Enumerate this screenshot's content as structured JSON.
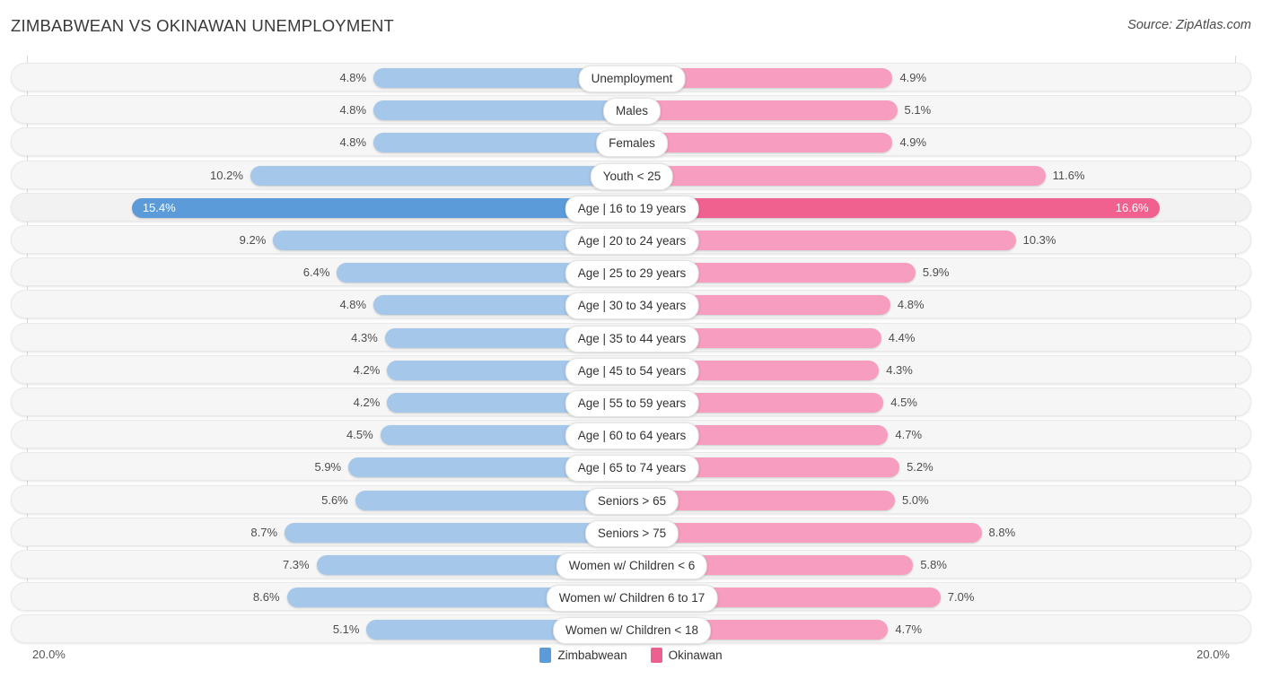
{
  "header": {
    "title": "ZIMBABWEAN VS OKINAWAN UNEMPLOYMENT",
    "source": "Source: ZipAtlas.com"
  },
  "axis": {
    "left_label": "20.0%",
    "right_label": "20.0%"
  },
  "legend": [
    {
      "label": "Zimbabwean",
      "color": "#5b9bd9"
    },
    {
      "label": "Okinawan",
      "color": "#ec5f91"
    }
  ],
  "colors": {
    "left_normal": "#a4c7ea",
    "right_normal": "#f79ec0",
    "left_highlight": "#5b9bd9",
    "right_highlight": "#f0618f",
    "row_bg": "#f6f6f6"
  },
  "chart_data": {
    "type": "bar",
    "orientation": "diverging-horizontal",
    "title": "ZIMBABWEAN VS OKINAWAN UNEMPLOYMENT",
    "xlabel": "",
    "ylabel": "",
    "xlim": [
      20.0,
      20.0
    ],
    "grid": false,
    "legend_position": "bottom-center",
    "unit": "%",
    "series": [
      {
        "name": "Zimbabwean",
        "values": [
          4.8,
          4.8,
          4.8,
          10.2,
          15.4,
          9.2,
          6.4,
          4.8,
          4.3,
          4.2,
          4.2,
          4.5,
          5.9,
          5.6,
          8.7,
          7.3,
          8.6,
          5.1
        ]
      },
      {
        "name": "Okinawan",
        "values": [
          4.9,
          5.1,
          4.9,
          11.6,
          16.6,
          10.3,
          5.9,
          4.8,
          4.4,
          4.3,
          4.5,
          4.7,
          5.2,
          5.0,
          8.8,
          5.8,
          7.0,
          4.7
        ]
      }
    ],
    "categories": [
      "Unemployment",
      "Males",
      "Females",
      "Youth < 25",
      "Age | 16 to 19 years",
      "Age | 20 to 24 years",
      "Age | 25 to 29 years",
      "Age | 30 to 34 years",
      "Age | 35 to 44 years",
      "Age | 45 to 54 years",
      "Age | 55 to 59 years",
      "Age | 60 to 64 years",
      "Age | 65 to 74 years",
      "Seniors > 65",
      "Seniors > 75",
      "Women w/ Children < 6",
      "Women w/ Children 6 to 17",
      "Women w/ Children < 18"
    ],
    "rows": [
      {
        "category": "Unemployment",
        "left_value": 4.8,
        "right_value": 4.9,
        "left_label": "4.8%",
        "right_label": "4.9%",
        "highlight": false
      },
      {
        "category": "Males",
        "left_value": 4.8,
        "right_value": 5.1,
        "left_label": "4.8%",
        "right_label": "5.1%",
        "highlight": false
      },
      {
        "category": "Females",
        "left_value": 4.8,
        "right_value": 4.9,
        "left_label": "4.8%",
        "right_label": "4.9%",
        "highlight": false
      },
      {
        "category": "Youth < 25",
        "left_value": 10.2,
        "right_value": 11.6,
        "left_label": "10.2%",
        "right_label": "11.6%",
        "highlight": false
      },
      {
        "category": "Age | 16 to 19 years",
        "left_value": 15.4,
        "right_value": 16.6,
        "left_label": "15.4%",
        "right_label": "16.6%",
        "highlight": true
      },
      {
        "category": "Age | 20 to 24 years",
        "left_value": 9.2,
        "right_value": 10.3,
        "left_label": "9.2%",
        "right_label": "10.3%",
        "highlight": false
      },
      {
        "category": "Age | 25 to 29 years",
        "left_value": 6.4,
        "right_value": 5.9,
        "left_label": "6.4%",
        "right_label": "5.9%",
        "highlight": false
      },
      {
        "category": "Age | 30 to 34 years",
        "left_value": 4.8,
        "right_value": 4.8,
        "left_label": "4.8%",
        "right_label": "4.8%",
        "highlight": false
      },
      {
        "category": "Age | 35 to 44 years",
        "left_value": 4.3,
        "right_value": 4.4,
        "left_label": "4.3%",
        "right_label": "4.4%",
        "highlight": false
      },
      {
        "category": "Age | 45 to 54 years",
        "left_value": 4.2,
        "right_value": 4.3,
        "left_label": "4.2%",
        "right_label": "4.3%",
        "highlight": false
      },
      {
        "category": "Age | 55 to 59 years",
        "left_value": 4.2,
        "right_value": 4.5,
        "left_label": "4.2%",
        "right_label": "4.5%",
        "highlight": false
      },
      {
        "category": "Age | 60 to 64 years",
        "left_value": 4.5,
        "right_value": 4.7,
        "left_label": "4.5%",
        "right_label": "4.7%",
        "highlight": false
      },
      {
        "category": "Age | 65 to 74 years",
        "left_value": 5.9,
        "right_value": 5.2,
        "left_label": "5.9%",
        "right_label": "5.2%",
        "highlight": false
      },
      {
        "category": "Seniors > 65",
        "left_value": 5.6,
        "right_value": 5.0,
        "left_label": "5.6%",
        "right_label": "5.0%",
        "highlight": false
      },
      {
        "category": "Seniors > 75",
        "left_value": 8.7,
        "right_value": 8.8,
        "left_label": "8.7%",
        "right_label": "8.8%",
        "highlight": false
      },
      {
        "category": "Women w/ Children < 6",
        "left_value": 7.3,
        "right_value": 5.8,
        "left_label": "7.3%",
        "right_label": "5.8%",
        "highlight": false
      },
      {
        "category": "Women w/ Children 6 to 17",
        "left_value": 8.6,
        "right_value": 7.0,
        "left_label": "8.6%",
        "right_label": "7.0%",
        "highlight": false
      },
      {
        "category": "Women w/ Children < 18",
        "left_value": 5.1,
        "right_value": 4.7,
        "left_label": "5.1%",
        "right_label": "4.7%",
        "highlight": false
      }
    ]
  }
}
